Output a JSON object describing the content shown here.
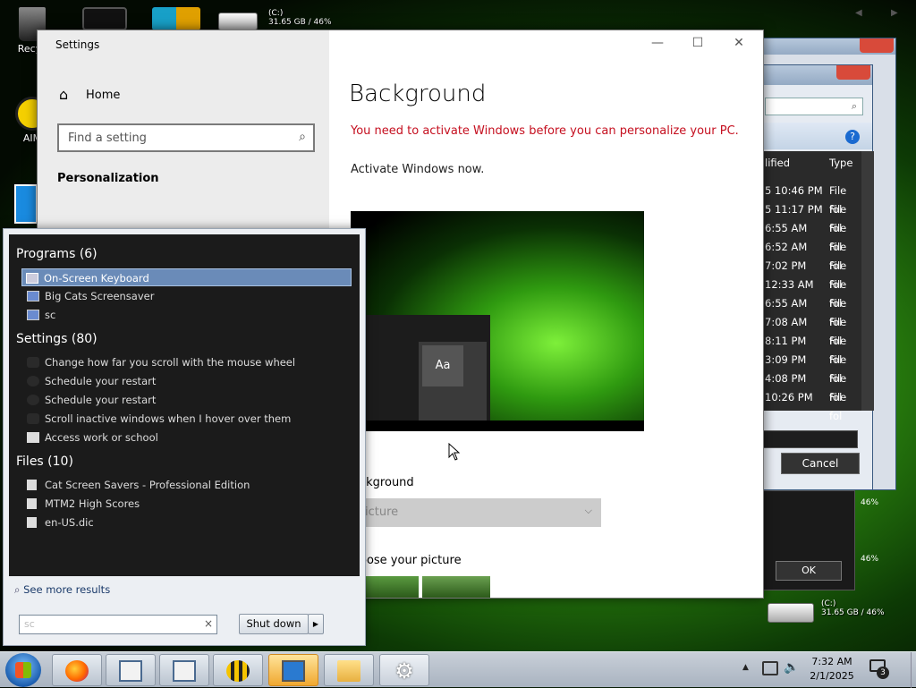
{
  "desktop": {
    "icons": [
      {
        "label": "Recyc",
        "icon": "recycle-bin-icon"
      },
      {
        "label": "AIM",
        "icon": "aim-icon"
      }
    ],
    "drive_top": {
      "name": "(C:)",
      "info": "31.65 GB / 46%"
    },
    "drive_bottom": {
      "name": "(C:)",
      "info": "31.65 GB / 46%"
    },
    "right_edge_nav": {
      "prev": "◀",
      "next": "▶"
    }
  },
  "bg_explorer": {
    "columns": {
      "modified": "lified",
      "type": "Type"
    },
    "rows": [
      {
        "time": "5 10:46 PM",
        "type": "File fol"
      },
      {
        "time": "5 11:17 PM",
        "type": "File fol"
      },
      {
        "time": "6:55 AM",
        "type": "File fol"
      },
      {
        "time": "6:52 AM",
        "type": "File fol"
      },
      {
        "time": "7:02 PM",
        "type": "File fol"
      },
      {
        "time": "12:33 AM",
        "type": "File fol"
      },
      {
        "time": "6:55 AM",
        "type": "File fol"
      },
      {
        "time": "7:08 AM",
        "type": "File fol"
      },
      {
        "time": "8:11 PM",
        "type": "File fol"
      },
      {
        "time": "3:09 PM",
        "type": "File fol"
      },
      {
        "time": "4:08 PM",
        "type": "File fol"
      },
      {
        "time": "10:26 PM",
        "type": "File fol"
      }
    ],
    "cancel_label": "Cancel",
    "ok_label": "OK",
    "side_texts": [
      "46%",
      "46%",
      "46%"
    ]
  },
  "settings": {
    "title": "Settings",
    "home_label": "Home",
    "search_placeholder": "Find a setting",
    "section_label": "Personalization",
    "page_title": "Background",
    "warning": "You need to activate Windows before you can personalize your PC.",
    "activate_link": "Activate Windows now.",
    "preview_sample_text": "Aa",
    "background_label": "ckground",
    "background_value": "icture",
    "choose_label": "oose your picture"
  },
  "start_menu": {
    "groups": [
      {
        "title": "Programs (6)",
        "items": [
          {
            "label": "On-Screen Keyboard",
            "selected": true,
            "icon": "keyboard-icon"
          },
          {
            "label": "Big Cats Screensaver",
            "icon": "screensaver-icon"
          },
          {
            "label": "sc",
            "icon": "program-icon"
          }
        ]
      },
      {
        "title": "Settings (80)",
        "items": [
          {
            "label": "Change how far you scroll with the mouse wheel",
            "icon": "mouse-settings-icon"
          },
          {
            "label": "Schedule your restart",
            "icon": "restart-icon"
          },
          {
            "label": "Schedule your restart",
            "icon": "restart-icon"
          },
          {
            "label": "Scroll inactive windows when I hover over them",
            "icon": "mouse-settings-icon"
          },
          {
            "label": "Access work or school",
            "icon": "briefcase-icon"
          }
        ]
      },
      {
        "title": "Files (10)",
        "items": [
          {
            "label": "Cat Screen Savers - Professional Edition",
            "icon": "document-icon"
          },
          {
            "label": "MTM2 High Scores",
            "icon": "document-icon"
          },
          {
            "label": "en-US.dic",
            "icon": "document-icon"
          }
        ]
      }
    ],
    "see_more": "See more results",
    "search_value": "sc",
    "shutdown_label": "Shut down"
  },
  "taskbar": {
    "time": "7:32 AM",
    "date": "2/1/2025",
    "notification_count": "3"
  },
  "colors": {
    "warning": "#c50f1f",
    "selection": "#6a8bb8",
    "start_list_bg": "#1b1b1b"
  }
}
